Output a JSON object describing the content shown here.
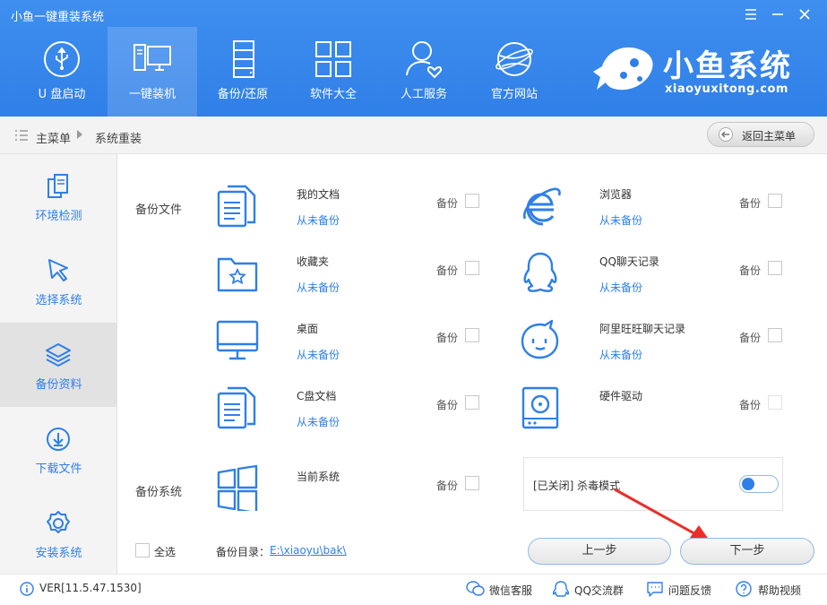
{
  "window": {
    "title": "小鱼一键重装系统"
  },
  "nav": [
    {
      "label": "U 盘启动",
      "icon": "usb-icon"
    },
    {
      "label": "一键装机",
      "icon": "computer-icon"
    },
    {
      "label": "备份/还原",
      "icon": "server-icon"
    },
    {
      "label": "软件大全",
      "icon": "grid-icon"
    },
    {
      "label": "人工服务",
      "icon": "user-heart-icon"
    },
    {
      "label": "官方网站",
      "icon": "globe-icon"
    }
  ],
  "logo": {
    "main": "小鱼系统",
    "sub": "xiaoyuxitong.com"
  },
  "breadcrumb": {
    "root": "主菜单",
    "current": "系统重装",
    "back_label": "返回主菜单"
  },
  "sidebar": [
    {
      "label": "环境检测",
      "icon": "copy-icon"
    },
    {
      "label": "选择系统",
      "icon": "cursor-icon"
    },
    {
      "label": "备份资料",
      "icon": "layers-icon",
      "active": true
    },
    {
      "label": "下载文件",
      "icon": "download-icon"
    },
    {
      "label": "安装系统",
      "icon": "settings-icon"
    }
  ],
  "sections": {
    "files": "备份文件",
    "system": "备份系统"
  },
  "backup_label": "备份",
  "status_never": "从未备份",
  "items": {
    "my_docs": {
      "name": "我的文档",
      "status": "从未备份"
    },
    "browser": {
      "name": "浏览器",
      "status": "从未备份"
    },
    "favorites": {
      "name": "收藏夹",
      "status": "从未备份"
    },
    "qq_chat": {
      "name": "QQ聊天记录",
      "status": "从未备份"
    },
    "desktop": {
      "name": "桌面",
      "status": "从未备份"
    },
    "wangwang": {
      "name": "阿里旺旺聊天记录",
      "status": "从未备份"
    },
    "c_docs": {
      "name": "C盘文档",
      "status": "从未备份"
    },
    "drivers": {
      "name": "硬件驱动",
      "status": ""
    },
    "current_system": {
      "name": "当前系统",
      "status": ""
    }
  },
  "antivirus": {
    "text": "[已关闭] 杀毒模式",
    "enabled": false
  },
  "select_all": "全选",
  "backup_dir": {
    "label": "备份目录：",
    "path": "E:\\xiaoyu\\bak\\"
  },
  "buttons": {
    "prev": "上一步",
    "next": "下一步"
  },
  "footer": {
    "version": "VER[11.5.47.1530]",
    "links": [
      "微信客服",
      "QQ交流群",
      "问题反馈",
      "帮助视频"
    ]
  },
  "colors": {
    "primary": "#2f7fe8",
    "header": "#3a8bf0"
  }
}
